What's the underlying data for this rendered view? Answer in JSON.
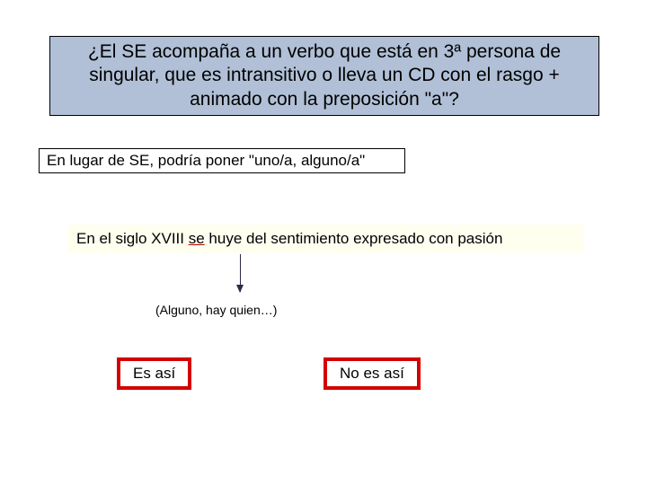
{
  "question": "¿El SE acompaña a un verbo que está en 3ª persona de singular, que es intransitivo o lleva un CD con el rasgo + animado con la preposición \"a\"?",
  "substitution_rule": "En lugar de SE, podría poner \"uno/a, alguno/a\"",
  "example": {
    "prefix": "En el siglo XVIII ",
    "highlight": "se",
    "suffix": " huye del sentimiento expresado con pasión"
  },
  "hint": "(Alguno, hay quien…)",
  "buttons": {
    "yes": "Es así",
    "no": "No es así"
  }
}
